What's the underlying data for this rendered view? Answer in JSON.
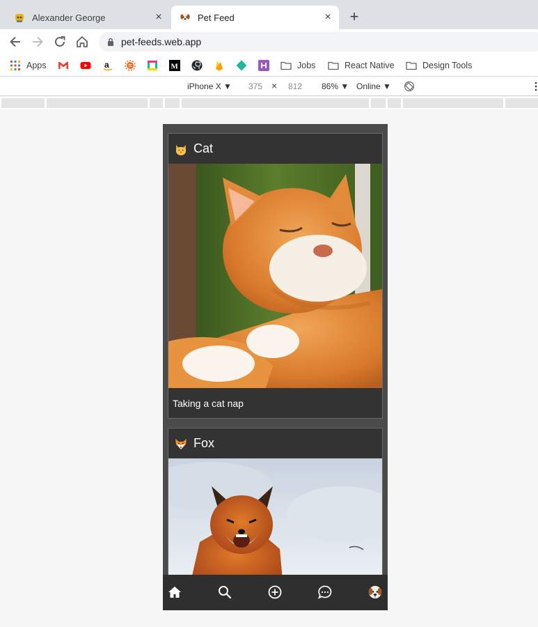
{
  "browser": {
    "tabs": [
      {
        "title": "Alexander George",
        "icon": "octocat-favicon-icon"
      },
      {
        "title": "Pet Feed",
        "icon": "dog-favicon-icon"
      }
    ],
    "url": "pet-feeds.web.app",
    "bookmarks": {
      "apps_label": "Apps",
      "folders": [
        "Jobs",
        "React Native",
        "Design Tools"
      ]
    }
  },
  "devtools": {
    "device": "iPhone X ▼",
    "width": "375",
    "times": "×",
    "height": "812",
    "zoom": "86% ▼",
    "network": "Online ▼"
  },
  "feed": {
    "posts": [
      {
        "animal": "Cat",
        "caption": "Taking a cat nap"
      },
      {
        "animal": "Fox",
        "caption": ""
      }
    ]
  },
  "colors": {
    "app_background": "#4b4b4b",
    "card_background": "#333333",
    "tabbar_background": "#2f2f2f",
    "text": "#ffffff"
  }
}
